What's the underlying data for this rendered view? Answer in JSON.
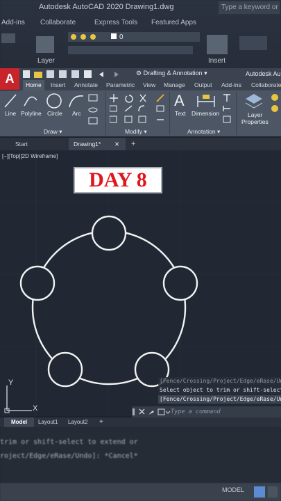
{
  "background_window": {
    "title": "Autodesk AutoCAD 2020   Drawing1.dwg",
    "search_placeholder": "Type a keyword or phrase",
    "tabs": [
      "Add-ins",
      "Collaborate",
      "Express Tools",
      "Featured Apps"
    ],
    "layer_label": "Layer",
    "layer_value": "0",
    "insert_label": "Insert"
  },
  "quick_access": {
    "workspace": "Drafting & Annotation",
    "product": "Autodesk Au"
  },
  "ribbon_tabs": [
    "Home",
    "Insert",
    "Annotate",
    "Parametric",
    "View",
    "Manage",
    "Output",
    "Add-ins",
    "Collaborate"
  ],
  "ribbon_active_tab": "Home",
  "draw_panel": {
    "title": "Draw",
    "tools": [
      "Line",
      "Polyline",
      "Circle",
      "Arc"
    ]
  },
  "modify_panel": {
    "title": "Modify"
  },
  "annotation_panel": {
    "title": "Annotation",
    "tools": [
      "Text",
      "Dimension"
    ]
  },
  "layer_properties": {
    "line1": "Layer",
    "line2": "Properties"
  },
  "document_tabs": {
    "start": "Start",
    "drawing": "Drawing1*",
    "add": "+",
    "close": "✕"
  },
  "viewport_label": "[−][Top][2D Wireframe]",
  "overlay_title": "DAY 8",
  "ucs": {
    "x": "X",
    "y": "Y"
  },
  "command_history": [
    "[Fence/Crossing/Project/Edge/eRase/Undo]:",
    "Select object to trim or shift-select",
    "[Fence/Crossing/Project/Edge/eRase/Undo]:"
  ],
  "command_placeholder": "Type a command",
  "layout_tabs": [
    "Model",
    "Layout1",
    "Layout2",
    "+"
  ],
  "background_command_lines": [
    "trim or shift-select to extend or",
    "roject/Edge/eRase/Undo]: *Cancel*"
  ],
  "status_model": "MODEL",
  "colors": {
    "accent_red": "#e0161d",
    "canvas": "#212833",
    "ribbon": "#4c5665",
    "logo_red": "#c7242b"
  }
}
